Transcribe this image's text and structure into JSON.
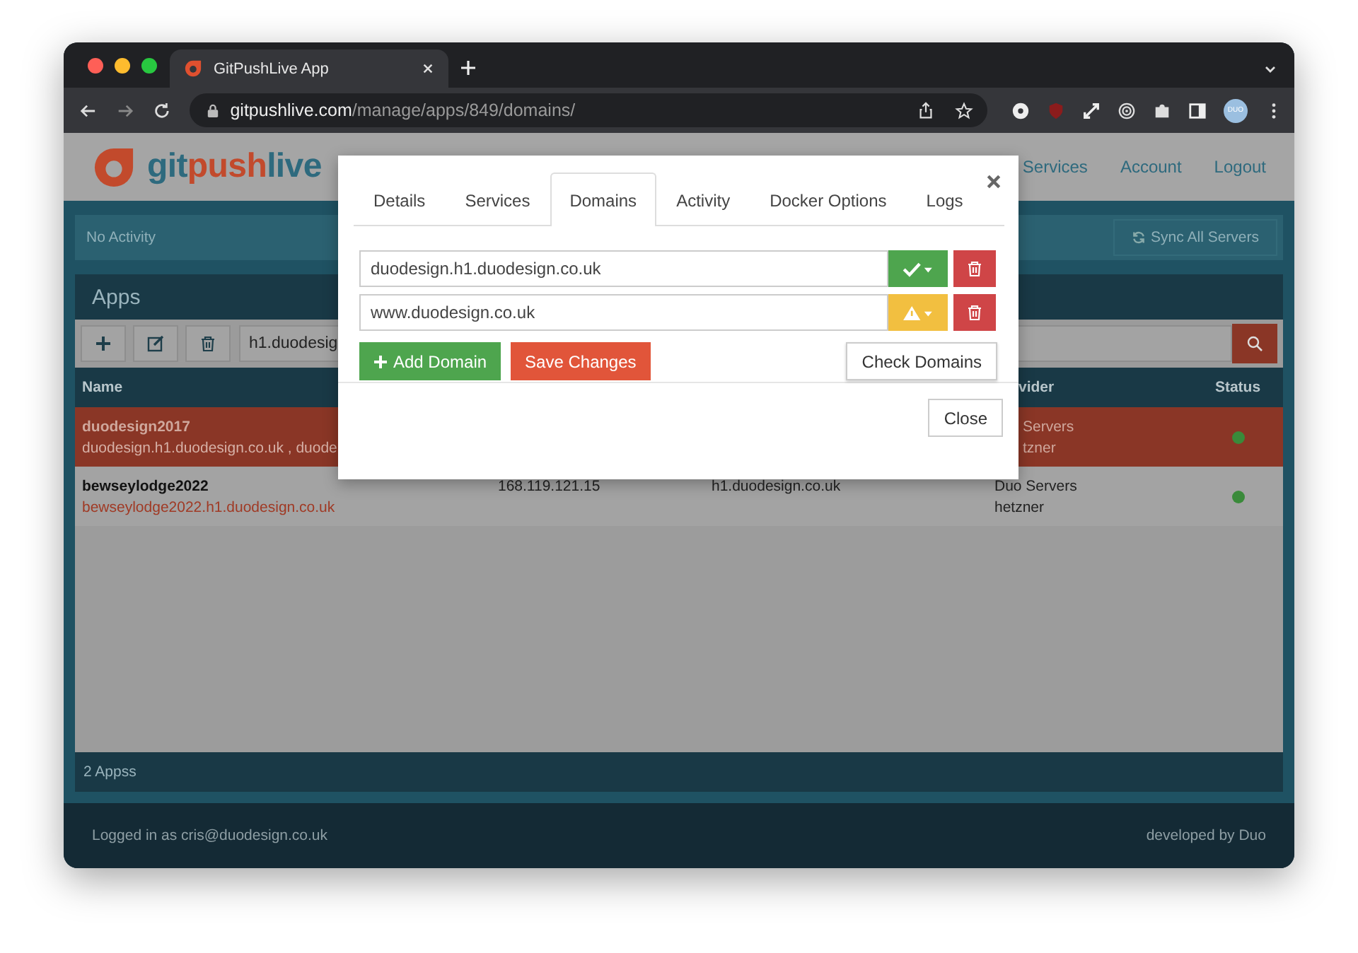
{
  "browser": {
    "tab_title": "GitPushLive App",
    "url_host": "gitpushlive.com",
    "url_path": "/manage/apps/849/domains/",
    "profile_label": "DUO"
  },
  "header": {
    "logo_parts": [
      {
        "text": "git",
        "color": "#2e6a7e"
      },
      {
        "text": "push",
        "color": "#c24a2c"
      },
      {
        "text": "live",
        "color": "#2e6a7e"
      }
    ],
    "nav": [
      "Services",
      "Account",
      "Logout"
    ]
  },
  "activity": {
    "text": "No Activity",
    "sync_button": "Sync All Servers"
  },
  "apps": {
    "title": "Apps",
    "search_value": "h1.duodesig",
    "name_header": "Name",
    "provider_header": "vider",
    "status_header": "Status",
    "rows": [
      {
        "name": "duodesign2017",
        "domains": "duodesign.h1.duodesign.co.uk , duode",
        "provider_lines": [
          "Servers",
          "tzner"
        ],
        "covered": true,
        "selected": true,
        "color": "#3a8a3a"
      },
      {
        "name": "bewseylodge2022",
        "domains": "bewseylodge2022.h1.duodesign.co.uk",
        "ip": "168.119.121.15",
        "server": "h1.duodesign.co.uk",
        "provider_lines": [
          "Duo Servers",
          "hetzner"
        ],
        "covered": false,
        "selected": false,
        "color": "#3a8a3a"
      }
    ],
    "count": "2 Appss"
  },
  "footer": {
    "logged_in": "Logged in as cris@duodesign.co.uk",
    "credit": "developed by Duo"
  },
  "modal": {
    "tabs": [
      {
        "label": "Details",
        "selected": false
      },
      {
        "label": "Services",
        "selected": false
      },
      {
        "label": "Domains",
        "selected": true
      },
      {
        "label": "Activity",
        "selected": false
      },
      {
        "label": "Docker Options",
        "selected": false
      },
      {
        "label": "Logs",
        "selected": false
      }
    ],
    "domains": [
      {
        "value": "duodesign.h1.duodesign.co.uk",
        "kind": "ok"
      },
      {
        "value": "www.duodesign.co.uk",
        "kind": "warning"
      }
    ],
    "add_button": "Add Domain",
    "save_button": "Save Changes",
    "check_button": "Check Domains",
    "close_button": "Close"
  }
}
